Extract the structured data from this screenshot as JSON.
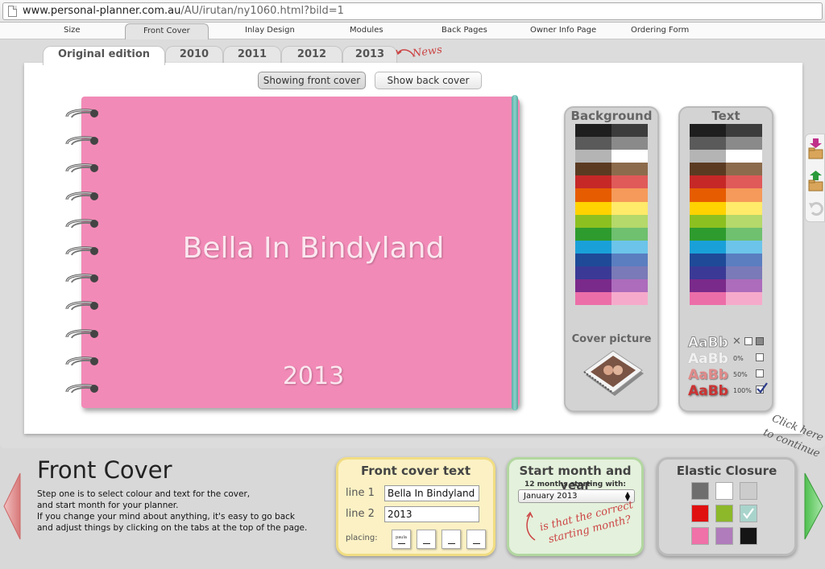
{
  "browser": {
    "url_domain": "www.personal-planner.com.au",
    "url_path": "/AU/irutan/ny1060.html?bild=1"
  },
  "topnav": {
    "items": [
      "Size",
      "Front Cover",
      "Inlay Design",
      "Modules",
      "Back Pages",
      "Owner Info Page",
      "Ordering Form"
    ],
    "active": "Front Cover"
  },
  "editions": {
    "tabs": [
      "Original edition",
      "2010",
      "2011",
      "2012",
      "2013"
    ],
    "active": "Original edition",
    "news": "News"
  },
  "cover_toggle": {
    "front": "Showing front cover",
    "back": "Show back cover",
    "active": "front"
  },
  "planner": {
    "title": "Bella In Bindyland",
    "year": "2013",
    "cover_color": "#f28ab7",
    "elastic_color": "#7cc9c1"
  },
  "background_panel": {
    "title": "Background",
    "swatches": [
      [
        "#1e1e1e",
        "#3c3c3c"
      ],
      [
        "#5a5a5a",
        "#8a8a8a"
      ],
      [
        "#b4b4b4",
        "#ffffff"
      ],
      [
        "#5b3a22",
        "#8c6b4c"
      ],
      [
        "#c62828",
        "#e05a5a"
      ],
      [
        "#e65c00",
        "#f59a5a"
      ],
      [
        "#ffd200",
        "#ffea6a"
      ],
      [
        "#8cc020",
        "#b5d96a"
      ],
      [
        "#2e9b2e",
        "#6fc06f"
      ],
      [
        "#1aa0d8",
        "#6cc4ea"
      ],
      [
        "#1e4a98",
        "#5a7ec0"
      ],
      [
        "#3a3a96",
        "#7a7ab8"
      ],
      [
        "#7a2a8a",
        "#ad6cbc"
      ],
      [
        "#ec6ea8",
        "#f6aacb"
      ]
    ],
    "cover_picture_label": "Cover picture"
  },
  "text_panel": {
    "title": "Text",
    "swatches": [
      [
        "#1e1e1e",
        "#3c3c3c"
      ],
      [
        "#5a5a5a",
        "#8a8a8a"
      ],
      [
        "#b4b4b4",
        "#ffffff"
      ],
      [
        "#5b3a22",
        "#8c6b4c"
      ],
      [
        "#c62828",
        "#e05a5a"
      ],
      [
        "#e65c00",
        "#f59a5a"
      ],
      [
        "#ffd200",
        "#ffea6a"
      ],
      [
        "#8cc020",
        "#b5d96a"
      ],
      [
        "#2e9b2e",
        "#6fc06f"
      ],
      [
        "#1aa0d8",
        "#6cc4ea"
      ],
      [
        "#1e4a98",
        "#5a7ec0"
      ],
      [
        "#3a3a96",
        "#7a7ab8"
      ],
      [
        "#7a2a8a",
        "#ad6cbc"
      ],
      [
        "#ec6ea8",
        "#f6aacb"
      ]
    ],
    "styles": [
      {
        "sample": "AaBb",
        "label": "",
        "icon": "close-icon",
        "checked": false
      },
      {
        "sample": "AaBb",
        "label": "0%",
        "checked": false
      },
      {
        "sample": "AaBb",
        "label": "50%",
        "checked": false
      },
      {
        "sample": "AaBb",
        "label": "100%",
        "checked": true
      }
    ]
  },
  "bottom": {
    "heading": "Front Cover",
    "description": "Step one is to select colour and text for the cover,\nand start month for your planner.\nIf you change your mind about anything, it's easy to go back\nand adjust things by clicking on the tabs at the top of the page."
  },
  "front_cover_text": {
    "title": "Front cover text",
    "line1_label": "line 1",
    "line1_value": "Bella In Bindyland",
    "line2_label": "line 2",
    "line2_value": "2013",
    "placing_label": "placing:",
    "placing_sample": "paula"
  },
  "start_month": {
    "title": "Start month and year",
    "subtitle": "12 months starting with:",
    "selected": "January 2013",
    "question": "is that the correct starting month?"
  },
  "elastic_closure": {
    "title": "Elastic Closure",
    "swatches": [
      "#6e6e6e",
      "#ffffff",
      "#cccccc",
      "#e01010",
      "#8cb82a",
      "#a8d4cc",
      "#f070a8",
      "#b07cbc",
      "#151515"
    ],
    "selected_index": 5
  },
  "continue_hint": "Click here to continue"
}
